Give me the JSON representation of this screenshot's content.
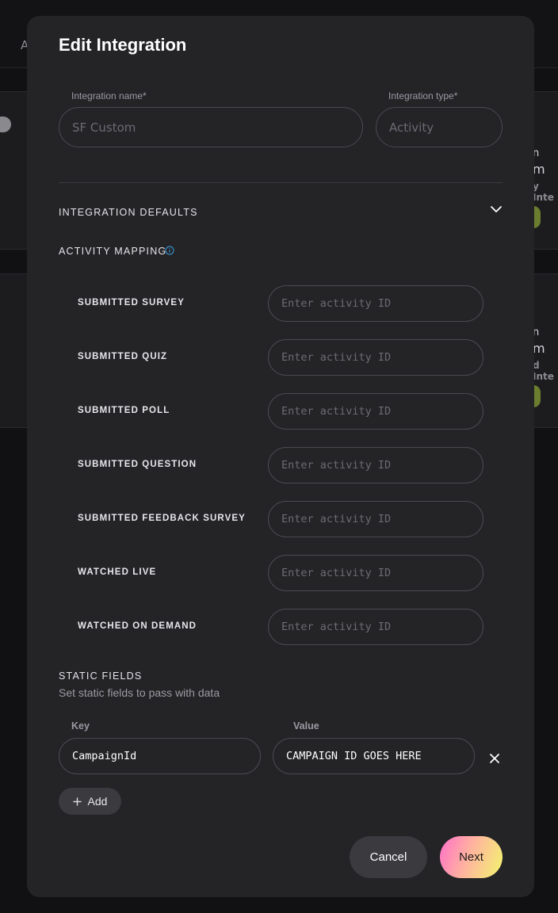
{
  "background": {
    "tab_label": "A",
    "card1_text": "n",
    "card1_text2": "m",
    "card1_sub": "y Inte",
    "card2_text": "n",
    "card2_text2": "m",
    "card2_sub": "d Inte"
  },
  "modal": {
    "title": "Edit Integration",
    "integration_name": {
      "label": "Integration name*",
      "placeholder": "SF Custom"
    },
    "integration_type": {
      "label": "Integration type*",
      "placeholder": "Activity"
    },
    "defaults_section": {
      "title": "INTEGRATION DEFAULTS",
      "icon": "chevron-down-icon"
    },
    "activity_mapping": {
      "title": "ACTIVITY MAPPING",
      "icon": "info-icon",
      "input_placeholder": "Enter activity ID",
      "rows": [
        {
          "label": "SUBMITTED SURVEY"
        },
        {
          "label": "SUBMITTED QUIZ"
        },
        {
          "label": "SUBMITTED POLL"
        },
        {
          "label": "SUBMITTED QUESTION"
        },
        {
          "label": "SUBMITTED FEEDBACK SURVEY"
        },
        {
          "label": "WATCHED LIVE"
        },
        {
          "label": "WATCHED ON DEMAND"
        }
      ]
    },
    "static_fields": {
      "title": "STATIC FIELDS",
      "subtitle": "Set static fields to pass with data",
      "key_label": "Key",
      "value_label": "Value",
      "rows": [
        {
          "key": "CampaignId",
          "value": "CAMPAIGN ID GOES HERE"
        }
      ],
      "add_label": "Add"
    },
    "cancel_label": "Cancel",
    "next_label": "Next"
  },
  "colors": {
    "modal_bg": "#242427",
    "page_bg": "#111113",
    "input_border": "#4a4a50",
    "info_accent": "#3aa0e0",
    "next_gradient": [
      "#ff6fc8",
      "#ffb2a0",
      "#f3f56e"
    ]
  }
}
